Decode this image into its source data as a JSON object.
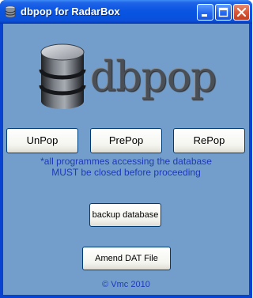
{
  "window": {
    "title": "dbpop for RadarBox",
    "app_icon": "database-icon",
    "controls": {
      "minimize_icon": "minimize-icon",
      "maximize_icon": "maximize-icon",
      "close_icon": "close-icon"
    }
  },
  "logo": {
    "icon": "database-cylinder-icon",
    "text": "dbpop"
  },
  "buttons": {
    "unpop": "UnPop",
    "prepop": "PrePop",
    "repop": "RePop",
    "backup": "backup database",
    "amend": "Amend DAT File"
  },
  "note": {
    "line1": "*all programmes accessing the database",
    "line2": "MUST be closed before proceeding"
  },
  "footer": {
    "copyright": "© Vmc 2010"
  },
  "colors": {
    "client_background": "#739ecb",
    "note_text": "#1e3ab8",
    "titlebar": "#0a55e2"
  }
}
